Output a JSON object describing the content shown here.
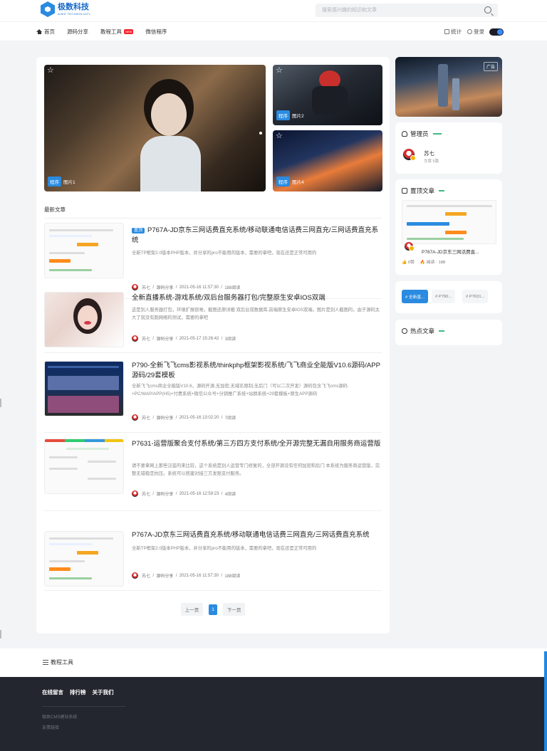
{
  "header": {
    "logo_cn": "极数科技",
    "logo_en": "AIMS TECHNOLOGY",
    "search_placeholder": "搜索感兴趣的知识和文章"
  },
  "nav": {
    "items": [
      "首页",
      "源码分享",
      "教程工具",
      "微信程序"
    ],
    "new_badge": "NEW",
    "stats": "统计",
    "login": "登录"
  },
  "slider": {
    "big": {
      "tag": "程序",
      "label": "图片1"
    },
    "small1": {
      "tag": "程序",
      "label": "图片2"
    },
    "small2": {
      "tag": "程序",
      "label": "图片4"
    }
  },
  "latest_title": "最新文章",
  "articles": [
    {
      "tag": "置顶",
      "title": "P767A-JD京东三网话费直充系统/移动联通电信话费三网直充/三网话费直充系统",
      "desc": "全新TP框架2.0版本PHP版本，并分享的pro不能用的版本，需要的拿吧，现在还是正常可用的",
      "author": "苏七",
      "category": "源码分享",
      "date": "2021-05-16 11:57:30",
      "views": "188阅读"
    },
    {
      "title": "全新直播系统-游戏系统/双后台服务器打包/完整原生安卓IOS双端",
      "desc": "这是别人服务器打包，环境扩展很难，截图还原详细 双后台双数据库,前端原生安卓IOS双端，图片是别人截图的，由于源码太大了就没有跑网络的测试，需要的拿吧",
      "author": "苏七",
      "category": "源码分享",
      "date": "2021-05-17 15:26:42",
      "views": "3阅读"
    },
    {
      "title": "P790-全新飞飞cms影视系统/thinkphp框架影视系统/飞飞商业全能版V10.6源码/APP源码/29套模板",
      "desc": "全新飞飞cms商业全能版V10.6，源码开源,无加密,无域名限制,无后门（可以二次开发）源码包含飞飞cms源码+PC/WAP/APP(H5)+付费系统+微信公众号+分销推广系统+站群系统+29套模板+原生APP源码",
      "author": "苏七",
      "category": "源码分享",
      "date": "2021-05-16 13:02:20",
      "views": "7阅读"
    },
    {
      "title": "P7631-运营版聚合支付系统/第三方四方支付系统/全开源完整无漏自用服务商运营版",
      "desc": "请不要拿网上那些泛滥的来比较，这个系统是别人运营专门修复的，全部开源没有任何加密和后门 本系统为服务商运营版，完整无错稳定抗压。系统可以搭建对接三方发限支付服务。",
      "author": "苏七",
      "category": "源码分享",
      "date": "2021-05-16 12:59:23",
      "views": "4阅读"
    },
    {
      "title": "P767A-JD京东三网话费直充系统/移动联通电信话费三网直充/三网话费直充系统",
      "desc": "全新TP框架2.0版本PHP版本，并分享的pro不能用的版本，需要的拿吧，现在还是正常可用的",
      "author": "苏七",
      "category": "源码分享",
      "date": "2021-05-16 11:57:30",
      "views": "188阅读"
    }
  ],
  "pager": {
    "prev": "上一页",
    "current": "1",
    "next": "下一页"
  },
  "sidebar": {
    "ad_label": "广告",
    "admin_title": "管理员",
    "admin_name": "苏七",
    "admin_sub": "文章 5篇",
    "pinned_title": "置顶文章",
    "pinned_article": "P767A-JD京东三网话费直...",
    "pinned_likes": "0赞",
    "pinned_views": "阅读 · 188",
    "tags": [
      "# 全新直...",
      "# P790...",
      "# P7631..."
    ],
    "hot_title": "热点文章"
  },
  "tool_bar_label": "教程工具",
  "footer": {
    "links": [
      "在线留言",
      "排行榜",
      "关于我们"
    ],
    "line1": "极致CMS建站系统",
    "line2": "友情链接"
  },
  "colors": {
    "accent": "#2a8be0",
    "footer_bg": "#23262f",
    "dash": "#41b883"
  }
}
